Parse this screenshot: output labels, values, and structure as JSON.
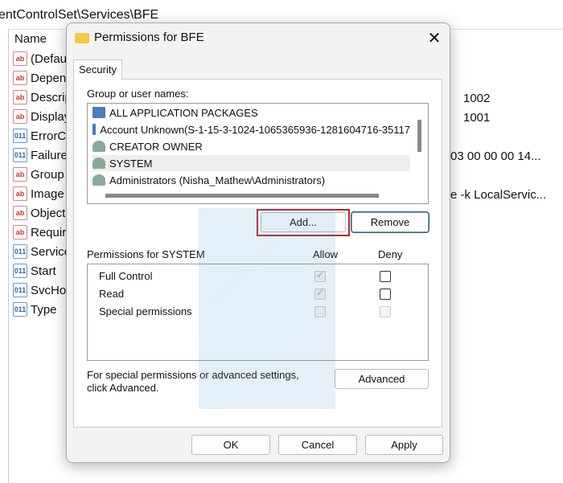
{
  "registry": {
    "path": "entControlSet\\Services\\BFE",
    "name_header": "Name",
    "items": [
      {
        "name": "(Defau",
        "type": "ab"
      },
      {
        "name": "Depen",
        "type": "ab"
      },
      {
        "name": "Descrip",
        "type": "ab"
      },
      {
        "name": "Display",
        "type": "ab"
      },
      {
        "name": "ErrorCo",
        "type": "bin"
      },
      {
        "name": "Failure",
        "type": "bin"
      },
      {
        "name": "Group",
        "type": "ab"
      },
      {
        "name": "Image",
        "type": "ab"
      },
      {
        "name": "Object",
        "type": "ab"
      },
      {
        "name": "Requir",
        "type": "ab"
      },
      {
        "name": "Service",
        "type": "bin"
      },
      {
        "name": "Start",
        "type": "bin"
      },
      {
        "name": "SvcHos",
        "type": "bin"
      },
      {
        "name": "Type",
        "type": "bin"
      }
    ],
    "values": [
      "1002",
      "1001",
      "03 00 00 00 14...",
      "e -k LocalServic..."
    ]
  },
  "dialog": {
    "title": "Permissions for BFE",
    "close": "✕",
    "tab": "Security",
    "group_label": "Group or user names:",
    "users": [
      {
        "name": "ALL APPLICATION PACKAGES",
        "icon": "app-package-icon"
      },
      {
        "name": "Account Unknown(S-1-15-3-1024-1065365936-1281604716-35117",
        "icon": "app-package-icon"
      },
      {
        "name": "CREATOR OWNER",
        "icon": "users-icon"
      },
      {
        "name": "SYSTEM",
        "icon": "users-icon",
        "selected": true
      },
      {
        "name": "Administrators (Nisha_Mathew\\Administrators)",
        "icon": "users-icon"
      }
    ],
    "add": "Add...",
    "remove": "Remove",
    "perm_label": "Permissions for SYSTEM",
    "allow": "Allow",
    "deny": "Deny",
    "permissions": [
      {
        "name": "Full Control",
        "allow": true,
        "allow_disabled": true,
        "deny": false,
        "deny_disabled": false
      },
      {
        "name": "Read",
        "allow": true,
        "allow_disabled": true,
        "deny": false,
        "deny_disabled": false
      },
      {
        "name": "Special permissions",
        "allow": false,
        "allow_disabled": true,
        "deny": false,
        "deny_disabled": true
      }
    ],
    "special_note_1": "For special permissions or advanced settings,",
    "special_note_2": "click Advanced.",
    "advanced": "Advanced",
    "ok": "OK",
    "cancel": "Cancel",
    "apply": "Apply",
    "highlight_color": "#c0202b"
  }
}
